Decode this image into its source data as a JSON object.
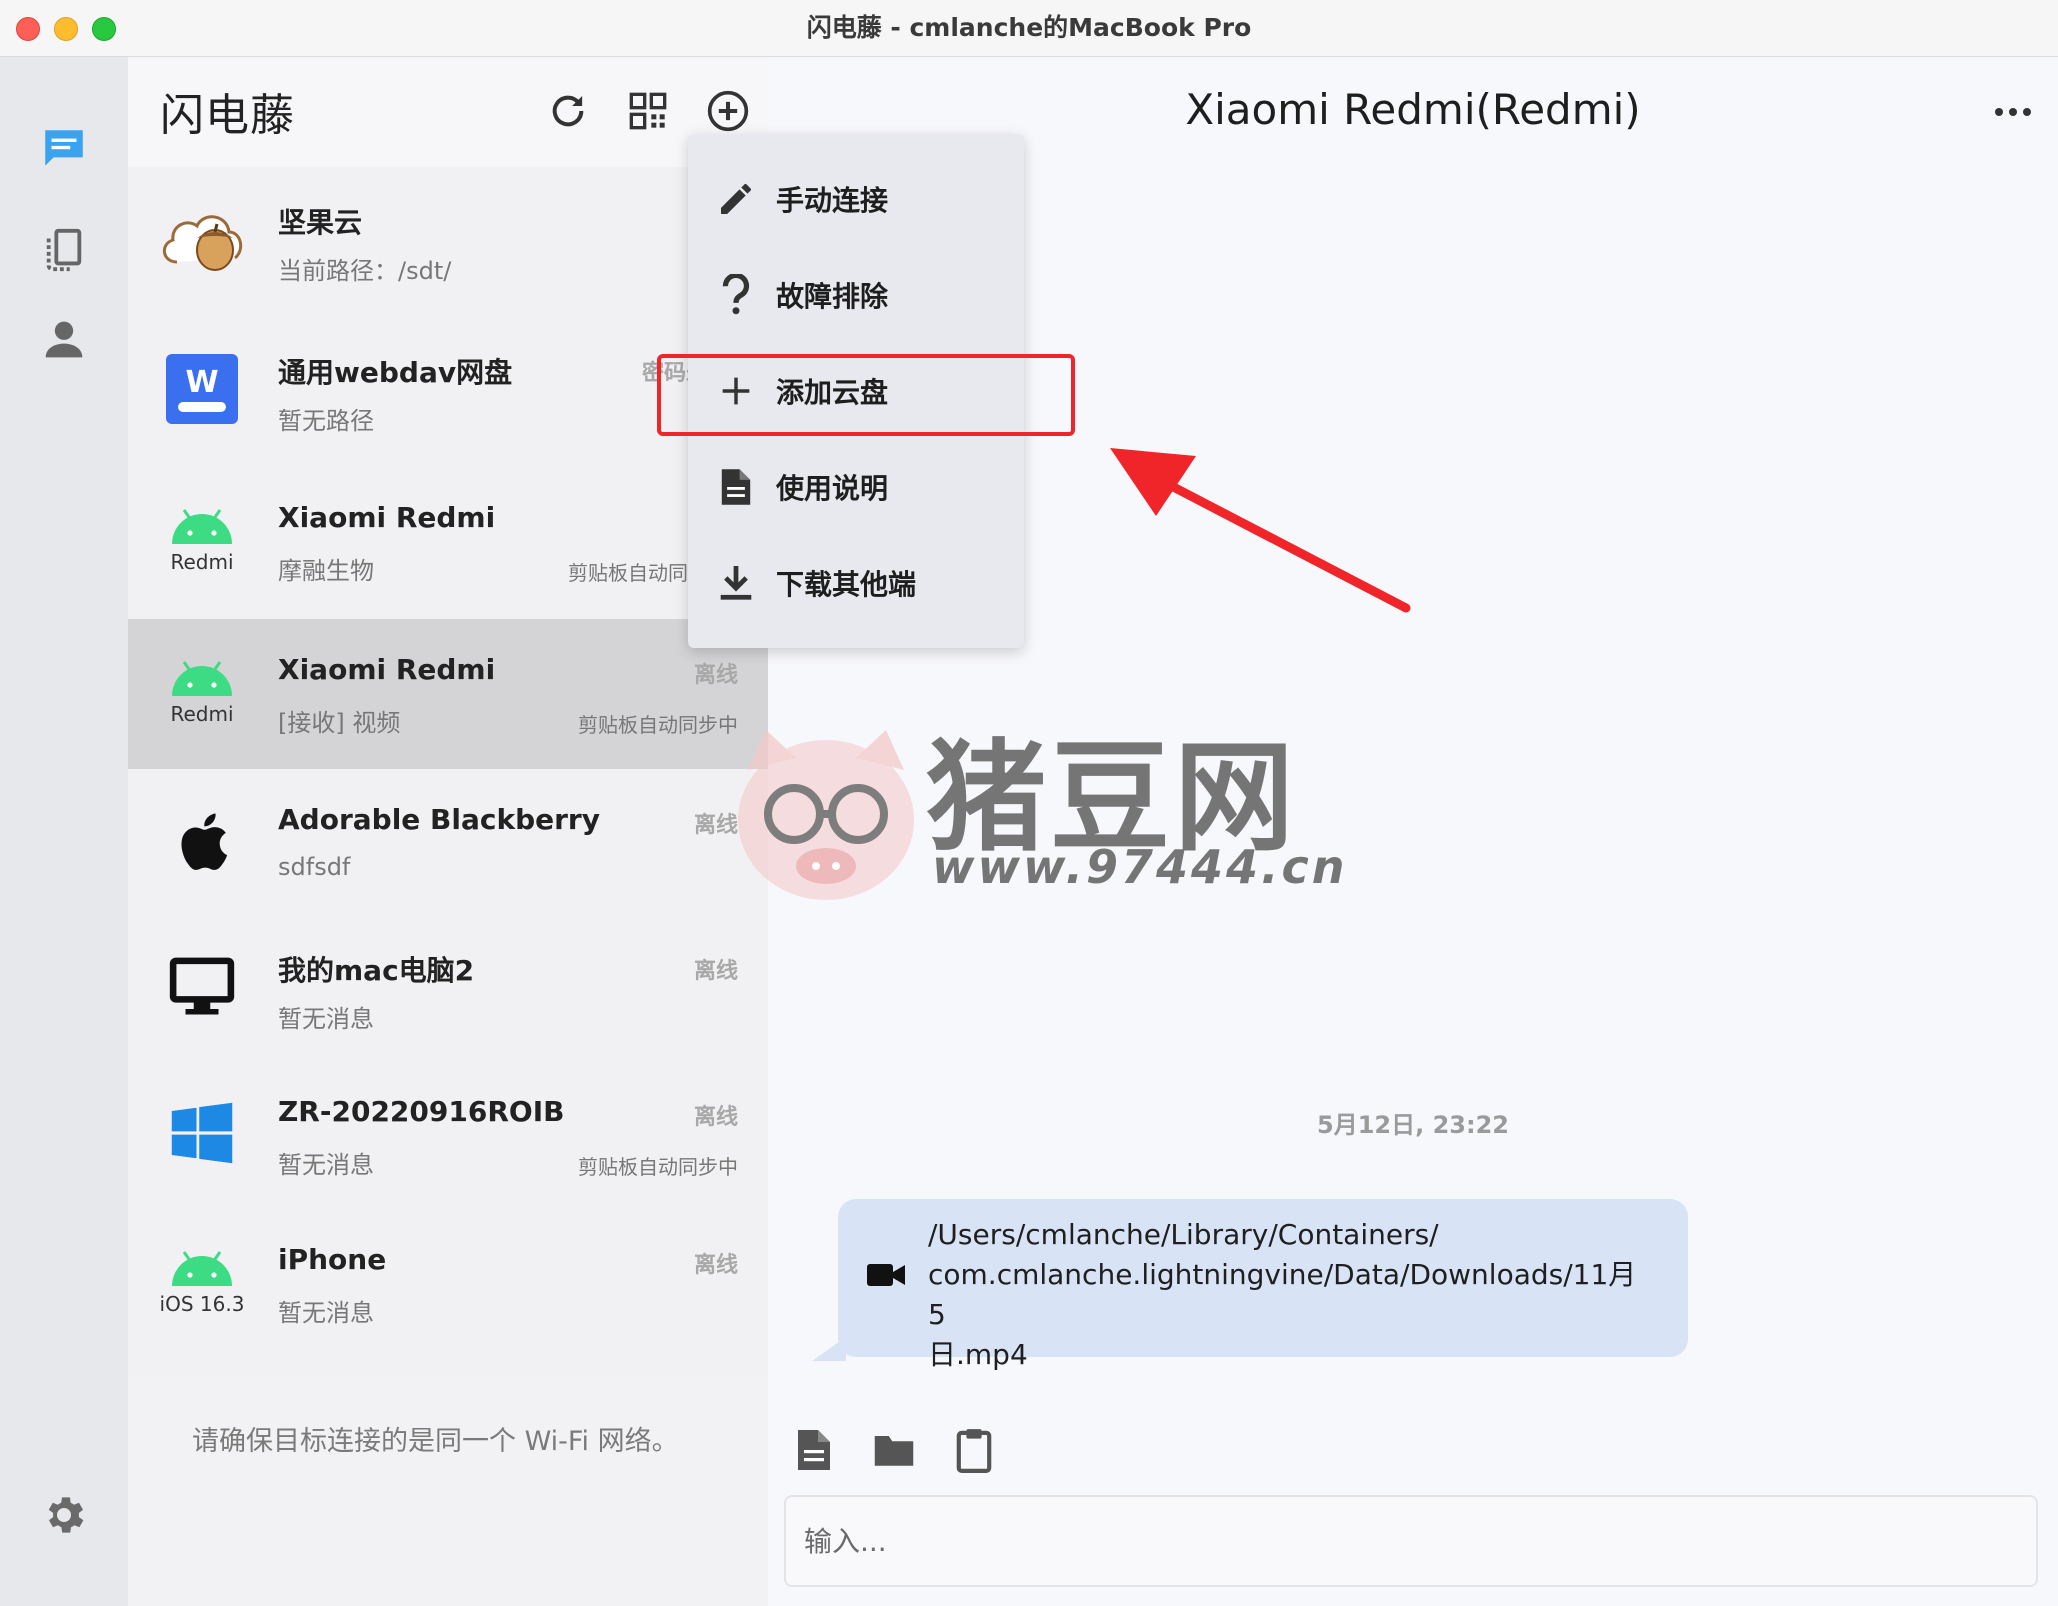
{
  "window": {
    "title": "闪电藤 - cmlanche的MacBook Pro"
  },
  "rail": {
    "items": [
      {
        "icon": "chat-icon",
        "color": "#3ba2ef"
      },
      {
        "icon": "devices-icon"
      },
      {
        "icon": "person-icon"
      }
    ],
    "settings_icon": "gear-icon"
  },
  "sidebar": {
    "app_name": "闪电藤",
    "header_icons": [
      "refresh-icon",
      "qr-code-icon",
      "add-circle-icon"
    ],
    "devices": [
      {
        "name": "坚果云",
        "message": "当前路径：/sdt/",
        "status": "",
        "clipboard": "",
        "icon": "nutstore-cloud-icon",
        "sub": ""
      },
      {
        "name": "通用webdav网盘",
        "message": "暂无路径",
        "status": "密码未",
        "clipboard": "",
        "icon": "webdav-icon",
        "sub": ""
      },
      {
        "name": "Xiaomi Redmi",
        "message": "摩融生物",
        "status": "",
        "clipboard": "剪贴板自动同",
        "icon": "android-icon",
        "sub": "Redmi"
      },
      {
        "name": "Xiaomi Redmi",
        "message": "[接收] 视频",
        "status": "离线",
        "clipboard": "剪贴板自动同步中",
        "icon": "android-icon",
        "sub": "Redmi"
      },
      {
        "name": "Adorable Blackberry",
        "message": "sdfsdf",
        "status": "离线",
        "clipboard": "",
        "icon": "apple-icon",
        "sub": ""
      },
      {
        "name": "我的mac电脑2",
        "message": "暂无消息",
        "status": "离线",
        "clipboard": "",
        "icon": "desktop-icon",
        "sub": ""
      },
      {
        "name": "ZR-20220916ROIB",
        "message": "暂无消息",
        "status": "离线",
        "clipboard": "剪贴板自动同步中",
        "icon": "windows-icon",
        "sub": ""
      },
      {
        "name": "iPhone",
        "message": "暂无消息",
        "status": "离线",
        "clipboard": "",
        "icon": "android-icon",
        "sub": "iOS 16.3"
      }
    ],
    "hint": "请确保目标连接的是同一个 Wi-Fi 网络。"
  },
  "menu": {
    "items": [
      {
        "label": "手动连接",
        "icon": "pencil-icon"
      },
      {
        "label": "故障排除",
        "icon": "question-icon"
      },
      {
        "label": "添加云盘",
        "icon": "plus-icon"
      },
      {
        "label": "使用说明",
        "icon": "document-icon"
      },
      {
        "label": "下载其他端",
        "icon": "download-icon"
      }
    ],
    "highlight_color": "#f0252a"
  },
  "chat": {
    "title": "Xiaomi Redmi(Redmi)",
    "timestamp": "5月12日, 23:22",
    "message": {
      "icon": "video-icon",
      "lines": [
        "/Users/cmlanche/Library/Containers/",
        "com.cmlanche.lightningvine/Data/Downloads/11月5",
        "日.mp4"
      ]
    },
    "toolbar": [
      "file-icon",
      "folder-icon",
      "clipboard-icon"
    ],
    "input_placeholder": "输入..."
  },
  "watermark": {
    "text": "猪豆网",
    "url": "www.97444.cn"
  }
}
